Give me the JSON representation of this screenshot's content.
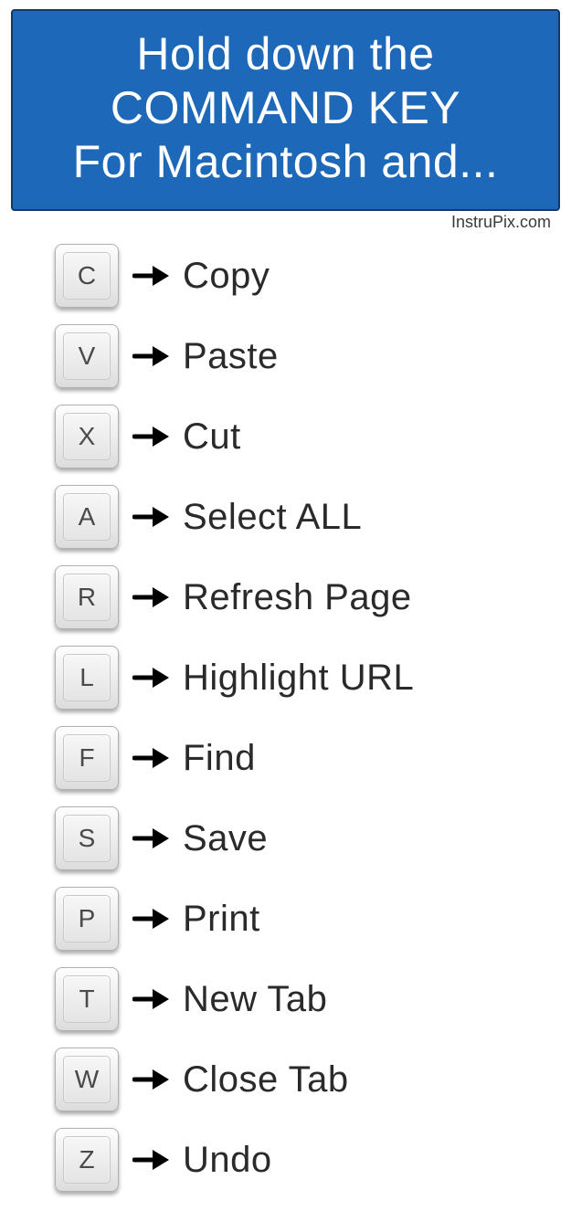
{
  "header": {
    "line1": "Hold down the",
    "line2": "COMMAND KEY",
    "line3": "For Macintosh and..."
  },
  "attribution": "InstruPix.com",
  "shortcuts": [
    {
      "key": "C",
      "action": "Copy"
    },
    {
      "key": "V",
      "action": "Paste"
    },
    {
      "key": "X",
      "action": "Cut"
    },
    {
      "key": "A",
      "action": "Select  ALL"
    },
    {
      "key": "R",
      "action": "Refresh Page"
    },
    {
      "key": "L",
      "action": "Highlight URL"
    },
    {
      "key": "F",
      "action": "Find"
    },
    {
      "key": "S",
      "action": "Save"
    },
    {
      "key": "P",
      "action": "Print"
    },
    {
      "key": "T",
      "action": "New Tab"
    },
    {
      "key": "W",
      "action": "Close Tab"
    },
    {
      "key": "Z",
      "action": "Undo"
    }
  ]
}
